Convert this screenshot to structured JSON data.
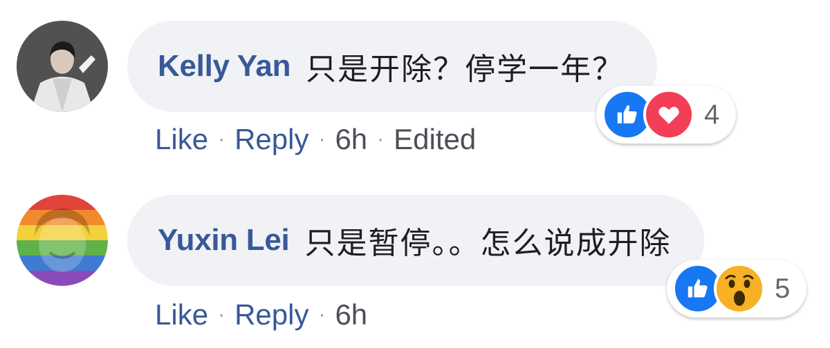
{
  "comments": [
    {
      "author": "Kelly Yan",
      "text": "只是开除？停学一年？",
      "actions": {
        "like": "Like",
        "reply": "Reply",
        "time": "6h",
        "edited": "Edited"
      },
      "reactions": {
        "icons": [
          "like-icon",
          "love-icon"
        ],
        "count": "4"
      }
    },
    {
      "author": "Yuxin Lei",
      "text": "只是暂停。。怎么说成开除",
      "actions": {
        "like": "Like",
        "reply": "Reply",
        "time": "6h"
      },
      "reactions": {
        "icons": [
          "like-icon",
          "wow-icon"
        ],
        "count": "5"
      }
    }
  ],
  "colors": {
    "bubble": "#f0f2f5",
    "author": "#385898",
    "like_blue": "#1877f2",
    "love_red": "#f33e58",
    "wow_yellow": "#f7b125"
  }
}
